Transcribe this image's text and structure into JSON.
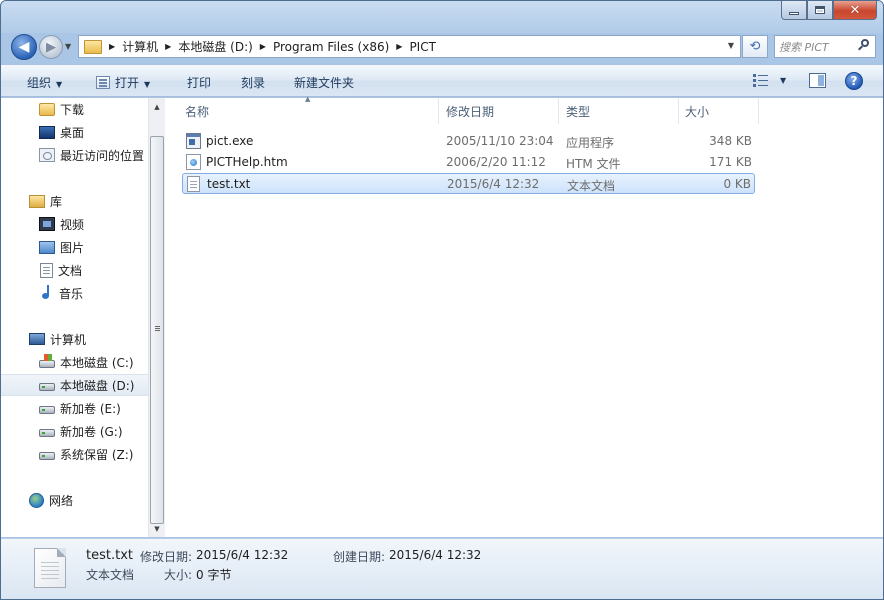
{
  "window": {
    "caption_min": "–",
    "caption_max": "□",
    "caption_close": "✕"
  },
  "address": {
    "crumbs": [
      "计算机",
      "本地磁盘 (D:)",
      "Program Files (x86)",
      "PICT"
    ],
    "search_placeholder": "搜索 PICT"
  },
  "toolbar": {
    "organize": "组织",
    "open": "打开",
    "print": "打印",
    "burn": "刻录",
    "new_folder": "新建文件夹"
  },
  "nav": {
    "favorites": [
      "下载",
      "桌面",
      "最近访问的位置"
    ],
    "library_label": "库",
    "libraries": [
      "视频",
      "图片",
      "文档",
      "音乐"
    ],
    "computer_label": "计算机",
    "drives": [
      "本地磁盘 (C:)",
      "本地磁盘 (D:)",
      "新加卷 (E:)",
      "新加卷 (G:)",
      "系统保留 (Z:)"
    ],
    "selected_drive": "本地磁盘 (D:)",
    "network_label": "网络"
  },
  "columns": {
    "name": "名称",
    "date": "修改日期",
    "type": "类型",
    "size": "大小"
  },
  "files": [
    {
      "name": "pict.exe",
      "date": "2005/11/10 23:04",
      "type": "应用程序",
      "size": "348 KB",
      "icon": "exe-icon",
      "selected": false
    },
    {
      "name": "PICTHelp.htm",
      "date": "2006/2/20 11:12",
      "type": "HTM 文件",
      "size": "171 KB",
      "icon": "htm-icon",
      "selected": false
    },
    {
      "name": "test.txt",
      "date": "2015/6/4 12:32",
      "type": "文本文档",
      "size": "0 KB",
      "icon": "txt-icon",
      "selected": true
    }
  ],
  "details": {
    "file_name": "test.txt",
    "modified_label": "修改日期:",
    "modified_value": "2015/6/4 12:32",
    "created_label": "创建日期:",
    "created_value": "2015/6/4 12:32",
    "file_type": "文本文档",
    "size_label": "大小:",
    "size_value": "0 字节"
  }
}
